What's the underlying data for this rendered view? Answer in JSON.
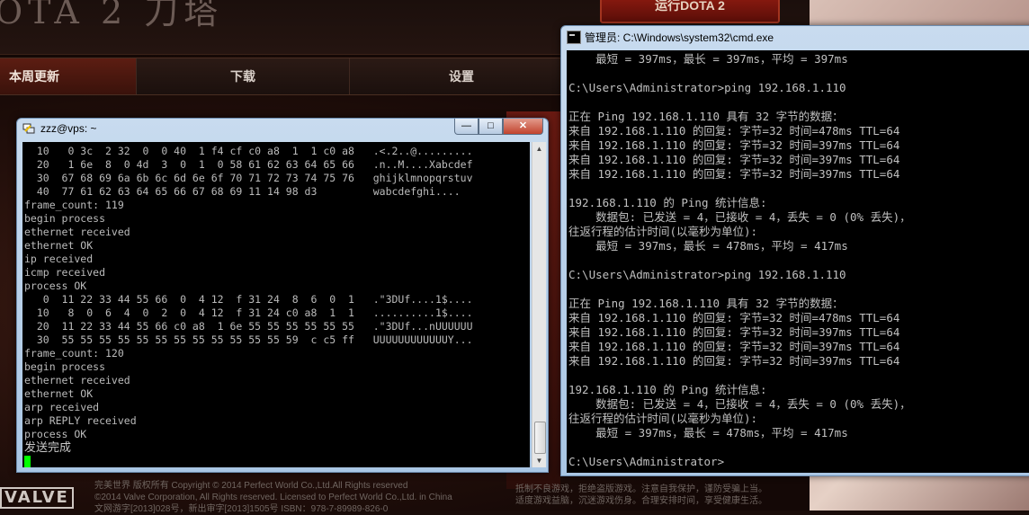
{
  "launcher": {
    "logo_text": "OTA 2 刀塔",
    "play_label": "运行DOTA 2",
    "tabs": [
      "本周更新",
      "下载",
      "设置"
    ],
    "footer_brand": "VALVE",
    "footer_copy": [
      "完美世界 版权所有 Copyright © 2014 Perfect World Co.,Ltd.All Rights reserved",
      "©2014 Valve Corporation, All Rights reserved. Licensed to Perfect World Co.,Ltd. in China",
      "文网游字[2013]028号，新出审字[2013]1505号 ISBN：978-7-89989-826-0"
    ],
    "footer_warning": [
      "抵制不良游戏，拒绝盗版游戏。注意自我保护，谨防受骗上当。",
      "适度游戏益脑，沉迷游戏伤身。合理安排时间，享受健康生活。"
    ]
  },
  "putty": {
    "title": "zzz@vps: ~",
    "controls": {
      "minimize": "—",
      "maximize": "□",
      "close": "✕"
    },
    "lines": [
      "  10   0 3c  2 32  0  0 40  1 f4 cf c0 a8  1  1 c0 a8   .<.2..@.........",
      "  20   1 6e  8  0 4d  3  0  1  0 58 61 62 63 64 65 66   .n..M....Xabcdef",
      "  30  67 68 69 6a 6b 6c 6d 6e 6f 70 71 72 73 74 75 76   ghijklmnopqrstuv",
      "  40  77 61 62 63 64 65 66 67 68 69 11 14 98 d3         wabcdefghi....",
      "frame_count: 119",
      "begin process",
      "ethernet received",
      "ethernet OK",
      "ip received",
      "icmp received",
      "process OK",
      "   0  11 22 33 44 55 66  0  4 12  f 31 24  8  6  0  1   .\"3DUf....1$....",
      "  10   8  0  6  4  0  2  0  4 12  f 31 24 c0 a8  1  1   ..........1$....",
      "  20  11 22 33 44 55 66 c0 a8  1 6e 55 55 55 55 55 55   .\"3DUf...nUUUUUU",
      "  30  55 55 55 55 55 55 55 55 55 55 55 55 59  c c5 ff   UUUUUUUUUUUUY...",
      "frame_count: 120",
      "begin process",
      "ethernet received",
      "ethernet OK",
      "arp received",
      "arp REPLY received",
      "process OK"
    ],
    "final_line": "发送完成"
  },
  "cmd": {
    "title": "管理员: C:\\Windows\\system32\\cmd.exe",
    "lines": [
      "    最短 = 397ms，最长 = 397ms，平均 = 397ms",
      "",
      "C:\\Users\\Administrator>ping 192.168.1.110",
      "",
      "正在 Ping 192.168.1.110 具有 32 字节的数据：",
      "来自 192.168.1.110 的回复: 字节=32 时间=478ms TTL=64",
      "来自 192.168.1.110 的回复: 字节=32 时间=397ms TTL=64",
      "来自 192.168.1.110 的回复: 字节=32 时间=397ms TTL=64",
      "来自 192.168.1.110 的回复: 字节=32 时间=397ms TTL=64",
      "",
      "192.168.1.110 的 Ping 统计信息:",
      "    数据包: 已发送 = 4，已接收 = 4，丢失 = 0 (0% 丢失)，",
      "往返行程的估计时间(以毫秒为单位):",
      "    最短 = 397ms，最长 = 478ms，平均 = 417ms",
      "",
      "C:\\Users\\Administrator>ping 192.168.1.110",
      "",
      "正在 Ping 192.168.1.110 具有 32 字节的数据：",
      "来自 192.168.1.110 的回复: 字节=32 时间=478ms TTL=64",
      "来自 192.168.1.110 的回复: 字节=32 时间=397ms TTL=64",
      "来自 192.168.1.110 的回复: 字节=32 时间=397ms TTL=64",
      "来自 192.168.1.110 的回复: 字节=32 时间=397ms TTL=64",
      "",
      "192.168.1.110 的 Ping 统计信息:",
      "    数据包: 已发送 = 4，已接收 = 4，丢失 = 0 (0% 丢失)，",
      "往返行程的估计时间(以毫秒为单位):",
      "    最短 = 397ms，最长 = 478ms，平均 = 417ms",
      "",
      "C:\\Users\\Administrator>"
    ]
  }
}
